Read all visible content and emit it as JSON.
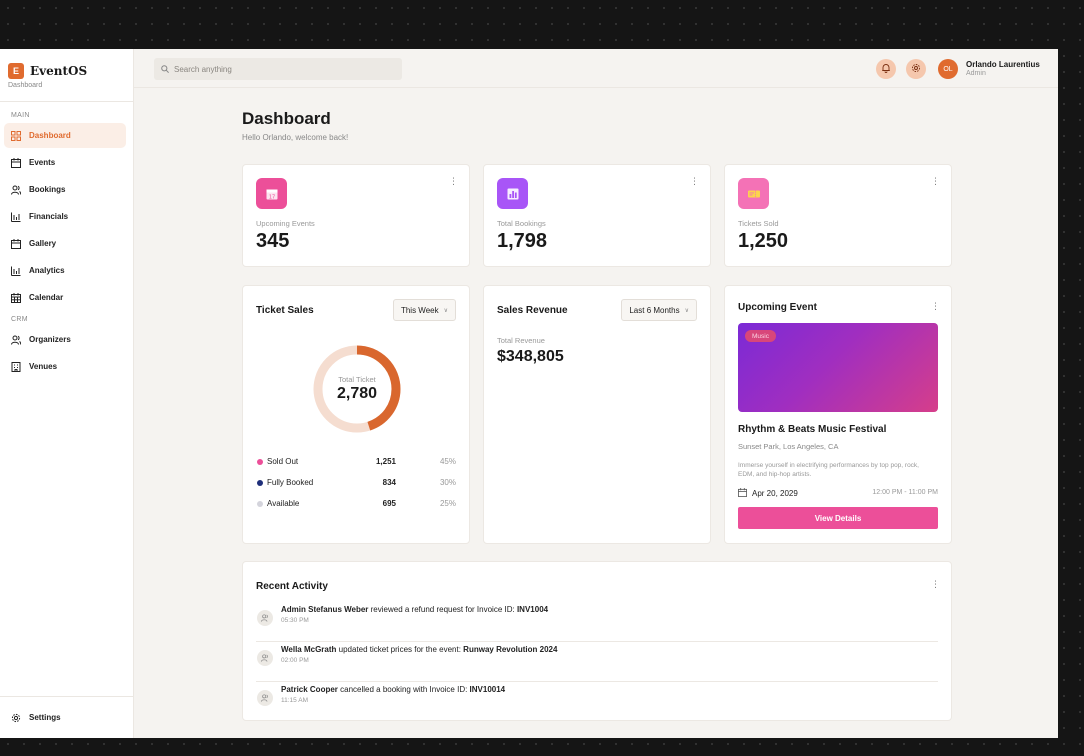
{
  "brand": {
    "logo_letter": "E",
    "name": "EventOS",
    "subtitle": "Dashboard"
  },
  "sidebar": {
    "main_label": "MAIN",
    "items": [
      {
        "label": "Dashboard",
        "icon": "grid-icon",
        "active": true
      },
      {
        "label": "Events",
        "icon": "calendar-icon"
      },
      {
        "label": "Bookings",
        "icon": "users-icon"
      },
      {
        "label": "Financials",
        "icon": "bar-chart-icon"
      },
      {
        "label": "Gallery",
        "icon": "calendar-icon"
      },
      {
        "label": "Analytics",
        "icon": "bar-chart-icon"
      },
      {
        "label": "Calendar",
        "icon": "calendar-grid-icon"
      }
    ],
    "crm_label": "CRM",
    "crm_items": [
      {
        "label": "Organizers",
        "icon": "users-icon"
      },
      {
        "label": "Venues",
        "icon": "building-icon"
      }
    ],
    "settings_label": "Settings"
  },
  "topbar": {
    "search_placeholder": "Search anything",
    "user": {
      "initials": "OL",
      "name": "Orlando Laurentius",
      "role": "Admin"
    }
  },
  "page": {
    "title": "Dashboard",
    "subtitle": "Hello Orlando, welcome back!"
  },
  "stats": [
    {
      "label": "Upcoming Events",
      "value": "345",
      "icon": "calendar-icon",
      "color": "#ec4f99"
    },
    {
      "label": "Total Bookings",
      "value": "1,798",
      "icon": "chart-icon",
      "color": "#a855f7"
    },
    {
      "label": "Tickets Sold",
      "value": "1,250",
      "icon": "ticket-icon",
      "color": "#f472b6"
    }
  ],
  "ticket_sales": {
    "title": "Ticket Sales",
    "period": "This Week",
    "center_label": "Total Ticket",
    "center_value": "2,780",
    "legend": [
      {
        "name": "Sold Out",
        "value": "1,251",
        "pct": "45%",
        "color": "#ec4f99"
      },
      {
        "name": "Fully Booked",
        "value": "834",
        "pct": "30%",
        "color": "#1f2f7a"
      },
      {
        "name": "Available",
        "value": "695",
        "pct": "25%",
        "color": "#d4d4dc"
      }
    ]
  },
  "sales_revenue": {
    "title": "Sales Revenue",
    "period": "Last 6 Months",
    "total_label": "Total Revenue",
    "total_value": "$348,805"
  },
  "upcoming_event": {
    "title": "Upcoming Event",
    "tag": "Music",
    "name": "Rhythm & Beats Music Festival",
    "location": "Sunset Park, Los Angeles, CA",
    "description": "Immerse yourself in electrifying performances by top pop, rock, EDM, and hip-hop artists.",
    "date": "Apr 20, 2029",
    "time": "12:00 PM - 11:00 PM",
    "button": "View Details"
  },
  "recent_activity": {
    "title": "Recent Activity",
    "items": [
      {
        "actor": "Admin Stefanus Weber",
        "action": " reviewed a refund request for Invoice ID: ",
        "target": "INV1004",
        "time": "05:30 PM"
      },
      {
        "actor": "Wella McGrath",
        "action": " updated ticket prices for the event: ",
        "target": "Runway Revolution 2024",
        "time": "02:00 PM"
      },
      {
        "actor": "Patrick Cooper",
        "action": " cancelled a booking with Invoice ID: ",
        "target": "INV10014",
        "time": "11:15 AM"
      }
    ]
  },
  "colors": {
    "accent": "#e06b2f",
    "active_bg": "#fbeee6",
    "donut_main": "#d9672e",
    "donut_track": "#f5ddd0",
    "cta": "#ec4f99"
  }
}
